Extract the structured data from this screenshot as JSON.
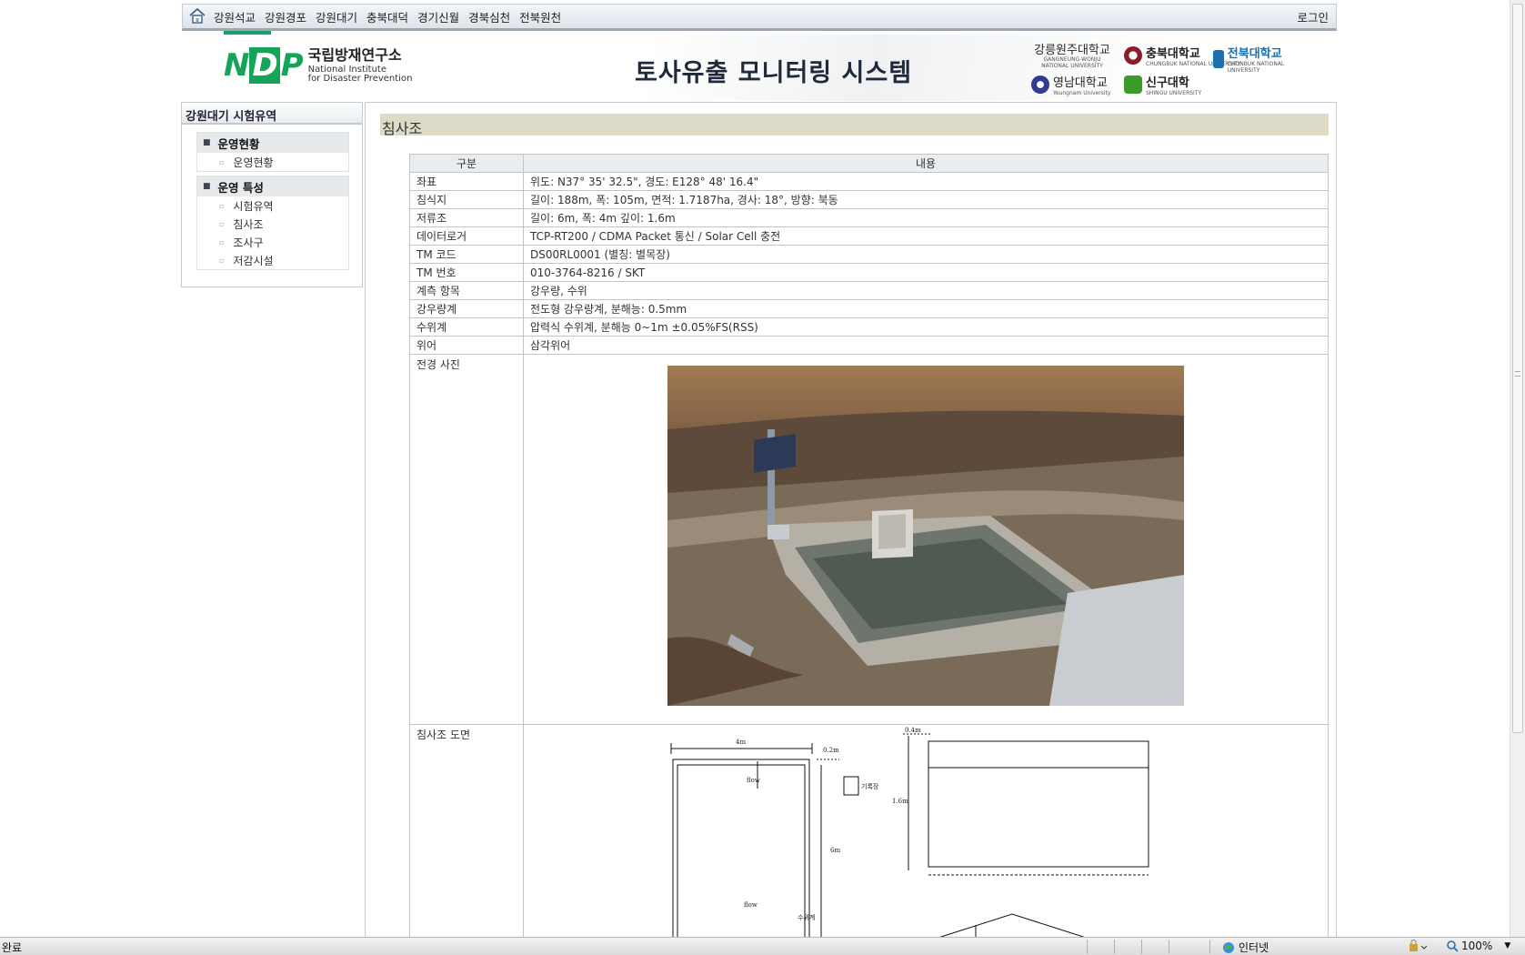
{
  "topnav": {
    "menu": [
      "강원석교",
      "강원경포",
      "강원대기",
      "충북대덕",
      "경기신월",
      "경북심천",
      "전북원천"
    ],
    "login": "로그인"
  },
  "header": {
    "logo_mark": "NDP",
    "logo_kr": "국립방재연구소",
    "logo_en1": "National Institute",
    "logo_en2": "for Disaster Prevention",
    "system_title": "토사유출 모니터링 시스템",
    "partners": [
      {
        "name": "강릉원주대학교",
        "sub": "GANGNEUNG-WONJU NATIONAL UNIVERSITY",
        "color": "#2a2a2a"
      },
      {
        "name": "충북대학교",
        "sub": "CHUNGBUK NATIONAL UNIVERSITY",
        "color": "#8a1c2b"
      },
      {
        "name": "전북대학교",
        "sub": "CHONBUK NATIONAL UNIVERSITY",
        "color": "#1a6fb0"
      },
      {
        "name": "영남대학교",
        "sub": "Yeungnam University",
        "color": "#2f3c8f"
      },
      {
        "name": "신구대학",
        "sub": "SHINGU UNIVERSITY",
        "color": "#3a9a2a"
      }
    ]
  },
  "sidebar": {
    "title": "강원대기 시험유역",
    "groups": [
      {
        "label": "운영현황",
        "items": [
          "운영현황"
        ]
      },
      {
        "label": "운영 특성",
        "items": [
          "시험유역",
          "침사조",
          "조사구",
          "저감시설"
        ]
      }
    ]
  },
  "main": {
    "section_title": "침사조",
    "table": {
      "headers": [
        "구분",
        "내용"
      ],
      "rows": [
        {
          "k": "좌표",
          "v": "위도: N37° 35' 32.5\", 경도: E128° 48' 16.4\""
        },
        {
          "k": "침식지",
          "v": "길이: 188m, 폭: 105m, 면적: 1.7187ha, 경사: 18°, 방향: 북동"
        },
        {
          "k": "저류조",
          "v": "길이: 6m, 폭: 4m 깊이: 1.6m"
        },
        {
          "k": "데이터로거",
          "v": "TCP-RT200 / CDMA Packet 통신 / Solar Cell 충전"
        },
        {
          "k": "TM 코드",
          "v": "DS00RL0001 (별칭: 별목장)"
        },
        {
          "k": "TM 번호",
          "v": "010-3764-8216 / SKT"
        },
        {
          "k": "계측 항목",
          "v": "강우량, 수위"
        },
        {
          "k": "강우량계",
          "v": "전도형 강우량계, 분해능: 0.5mm"
        },
        {
          "k": "수위계",
          "v": "압력식 수위계, 분해능 0~1m ±0.05%FS(RSS)"
        },
        {
          "k": "위어",
          "v": "삼각위어"
        }
      ],
      "photo_label": "전경 사진",
      "drawing_label": "침사조 도면"
    },
    "drawing": {
      "dim_4m": "4m",
      "dim_02m": "0.2m",
      "dim_6m": "6m",
      "dim_04m": "0.4m",
      "dim_16m": "1.6m",
      "flow": "flow",
      "logger": "기록장",
      "level": "수위계"
    }
  },
  "statusbar": {
    "status": "완료",
    "zone": "인터넷",
    "zoom": "100%"
  }
}
